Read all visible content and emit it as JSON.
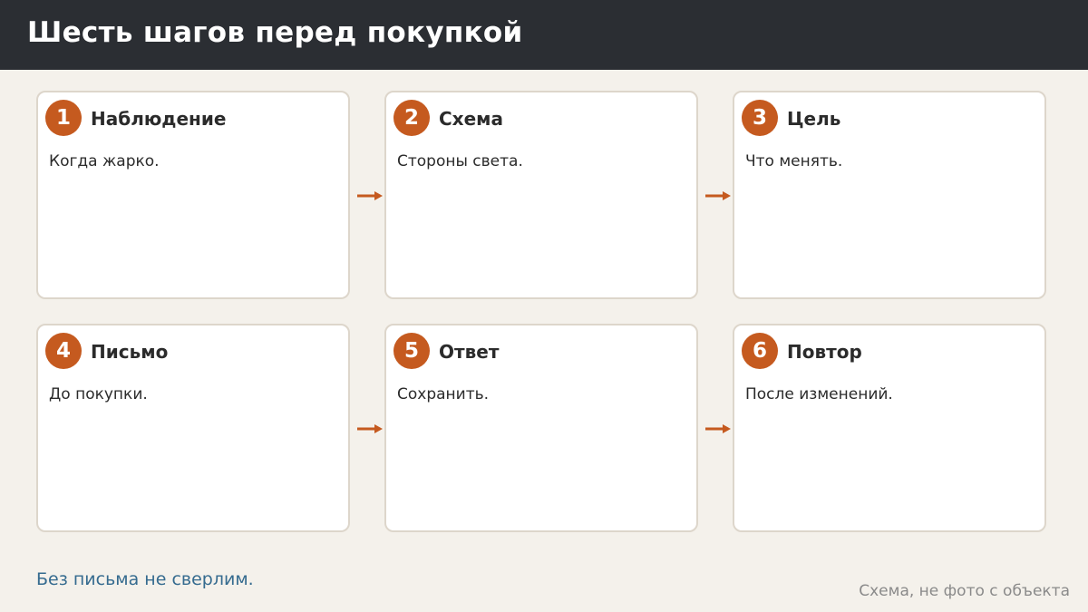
{
  "title": "Шесть шагов перед покупкой",
  "steps": [
    {
      "number": "1",
      "title": "Наблюдение",
      "text": "Когда жарко."
    },
    {
      "number": "2",
      "title": "Схема",
      "text": "Стороны света."
    },
    {
      "number": "3",
      "title": "Цель",
      "text": "Что менять."
    },
    {
      "number": "4",
      "title": "Письмо",
      "text": "До покупки."
    },
    {
      "number": "5",
      "title": "Ответ",
      "text": "Сохранить."
    },
    {
      "number": "6",
      "title": "Повтор",
      "text": "После изменений."
    }
  ],
  "footnote": "Без письма не сверлим.",
  "source": "Схема, не фото с объекта",
  "colors": {
    "accent": "#c55a1f",
    "header_bg": "#2b2e33",
    "background": "#f4f1eb",
    "note": "#356b8f"
  }
}
